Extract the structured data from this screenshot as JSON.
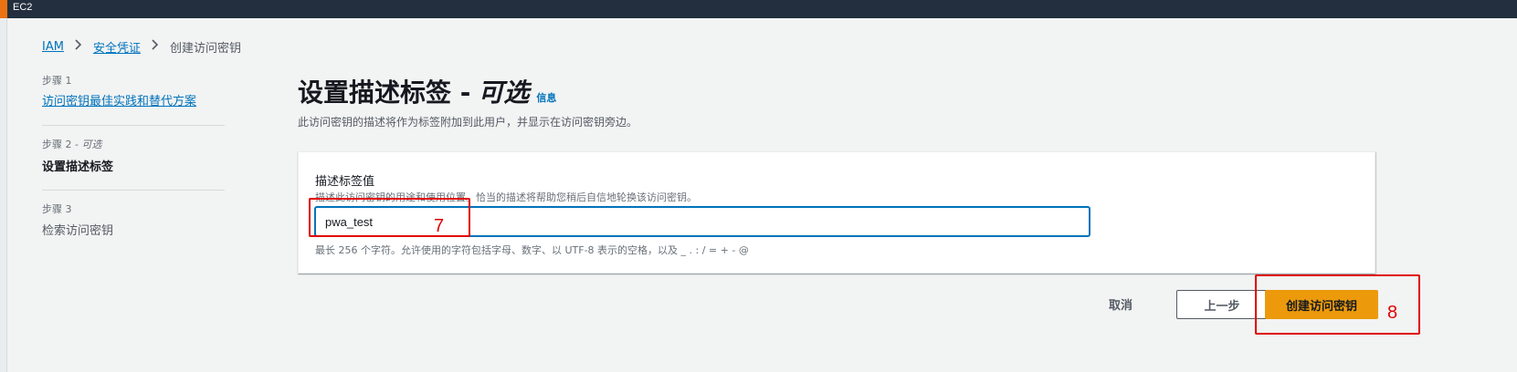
{
  "topbar": {
    "service_name": "EC2"
  },
  "breadcrumb": {
    "items": [
      {
        "label": "IAM"
      },
      {
        "label": "安全凭证"
      },
      {
        "label": "创建访问密钥"
      }
    ]
  },
  "steps": [
    {
      "step": "步骤 1",
      "title": "访问密钥最佳实践和替代方案"
    },
    {
      "step": "步骤 2 -",
      "optional": "可选",
      "title": "设置描述标签"
    },
    {
      "step": "步骤 3",
      "title": "检索访问密钥"
    }
  ],
  "page": {
    "title": "设置描述标签 -",
    "title_optional": "可选",
    "info_link": "信息",
    "description": "此访问密钥的描述将作为标签附加到此用户，并显示在访问密钥旁边。"
  },
  "form": {
    "label": "描述标签值",
    "help": "描述此访问密钥的用途和使用位置。恰当的描述将帮助您稍后自信地轮换该访问密钥。",
    "value": "pwa_test",
    "constraint": "最长 256 个字符。允许使用的字符包括字母、数字、以 UTF-8 表示的空格，以及 _ . : / = + - @"
  },
  "actions": {
    "cancel": "取消",
    "previous": "上一步",
    "create": "创建访问密钥"
  },
  "annotations": [
    "7",
    "8"
  ],
  "colors": {
    "primary": "#ec9a0b",
    "link": "#0073bb",
    "annotation": "#e00000"
  }
}
